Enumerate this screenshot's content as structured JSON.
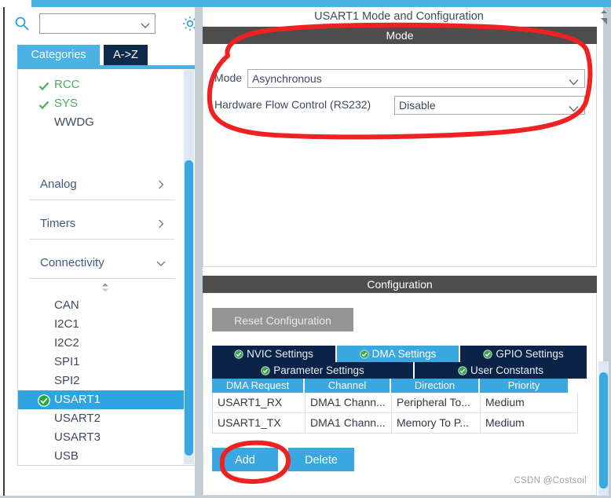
{
  "window": {
    "watermark": "CSDN @Costsoil"
  },
  "sidebar": {
    "search": {
      "value": "",
      "placeholder": "",
      "icon": "search-icon",
      "dropdown_icon": "chevron-down-icon"
    },
    "settings_icon": "gear-icon",
    "tabs": [
      {
        "label": "Categories",
        "selected": true
      },
      {
        "label": "A->Z",
        "selected": false
      }
    ],
    "top_items": [
      {
        "label": "RCC",
        "configured": true
      },
      {
        "label": "SYS",
        "configured": true
      },
      {
        "label": "WWDG",
        "configured": false
      }
    ],
    "groups": [
      {
        "label": "Analog",
        "expanded": false,
        "arrow": "chevron-right-icon"
      },
      {
        "label": "Timers",
        "expanded": false,
        "arrow": "chevron-right-icon"
      },
      {
        "label": "Connectivity",
        "expanded": true,
        "arrow": "chevron-down-icon"
      }
    ],
    "connectivity_items": [
      {
        "label": "CAN",
        "selected": false,
        "configured": false
      },
      {
        "label": "I2C1",
        "selected": false,
        "configured": false
      },
      {
        "label": "I2C2",
        "selected": false,
        "configured": false
      },
      {
        "label": "SPI1",
        "selected": false,
        "configured": false
      },
      {
        "label": "SPI2",
        "selected": false,
        "configured": false
      },
      {
        "label": "USART1",
        "selected": true,
        "configured": true
      },
      {
        "label": "USART2",
        "selected": false,
        "configured": false
      },
      {
        "label": "USART3",
        "selected": false,
        "configured": false
      },
      {
        "label": "USB",
        "selected": false,
        "configured": false
      }
    ]
  },
  "main": {
    "title": "USART1 Mode and Configuration",
    "mode_section": {
      "header": "Mode",
      "fields": [
        {
          "label": "Mode",
          "value": "Asynchronous"
        },
        {
          "label": "Hardware Flow Control (RS232)",
          "value": "Disable"
        }
      ]
    },
    "config_section": {
      "header": "Configuration",
      "reset_button": "Reset Configuration",
      "tabs_row1": [
        {
          "label": "NVIC Settings",
          "active": false,
          "status": "ok-check-icon"
        },
        {
          "label": "DMA Settings",
          "active": true,
          "status": "ok-check-icon"
        },
        {
          "label": "GPIO Settings",
          "active": false,
          "status": "ok-check-icon"
        }
      ],
      "tabs_row2": [
        {
          "label": "Parameter Settings",
          "active": false,
          "status": "ok-check-icon"
        },
        {
          "label": "User Constants",
          "active": false,
          "status": "ok-check-icon"
        }
      ],
      "dma_table": {
        "columns": [
          "DMA Request",
          "Channel",
          "Direction",
          "Priority"
        ],
        "rows": [
          [
            "USART1_RX",
            "DMA1 Chann...",
            "Peripheral To...",
            "Medium"
          ],
          [
            "USART1_TX",
            "DMA1 Chann...",
            "Memory To P...",
            "Medium"
          ]
        ]
      },
      "buttons": {
        "add": "Add",
        "delete": "Delete"
      }
    }
  },
  "colors": {
    "accent_blue": "#3aa8e0",
    "tab_dark": "#0c2348",
    "section_gray": "#4d4d4d",
    "annotation_red": "#ef2222",
    "ok_green": "#4aad5a"
  }
}
